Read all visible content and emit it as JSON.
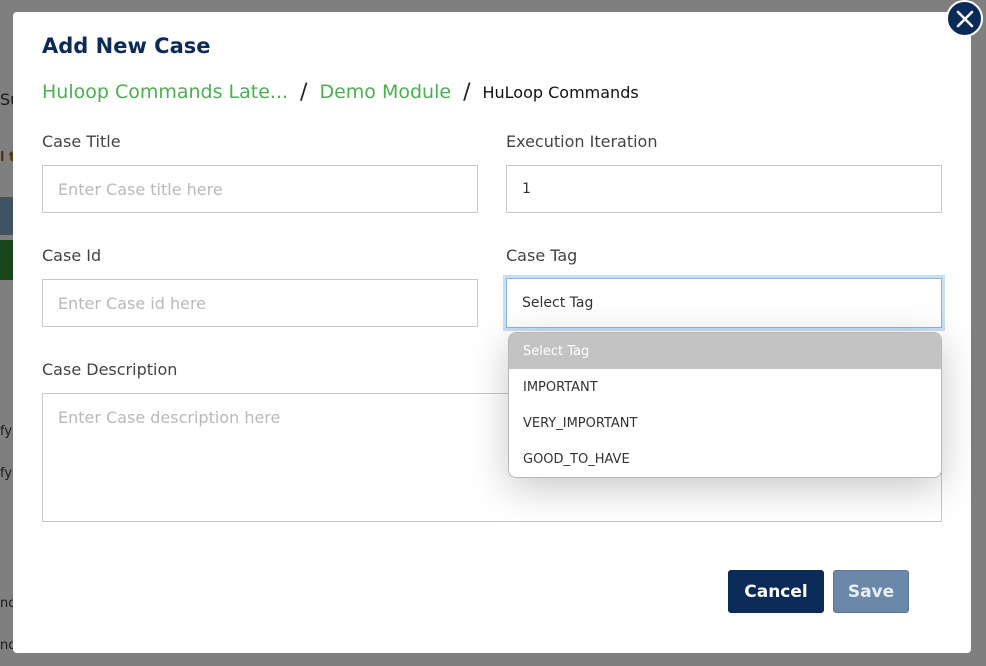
{
  "modal": {
    "title": "Add New Case",
    "breadcrumb": {
      "items": [
        {
          "label": "Huloop Commands Late..."
        },
        {
          "label": "Demo Module"
        }
      ],
      "separator": "/",
      "current": "HuLoop Commands"
    },
    "fields": {
      "case_title": {
        "label": "Case Title",
        "placeholder": "Enter Case title here",
        "value": ""
      },
      "execution_iteration": {
        "label": "Execution Iteration",
        "value": "1"
      },
      "case_id": {
        "label": "Case Id",
        "placeholder": "Enter Case id here",
        "value": ""
      },
      "case_tag": {
        "label": "Case Tag",
        "selected": "Select Tag",
        "options": [
          "Select Tag",
          "IMPORTANT",
          "VERY_IMPORTANT",
          "GOOD_TO_HAVE"
        ]
      },
      "case_description": {
        "label": "Case Description",
        "placeholder": "Enter Case description here",
        "value": ""
      }
    },
    "buttons": {
      "cancel": "Cancel",
      "save": "Save"
    },
    "close_icon": "close-icon"
  },
  "background": {
    "fragments": [
      "Su",
      "l t",
      "fy",
      "fy",
      "nd",
      "nd"
    ]
  },
  "colors": {
    "primary": "#0a2a57",
    "breadcrumb_link": "#4caf50",
    "save_button": "#6b88a8",
    "option_highlight": "#c3c3c3",
    "focus_ring": "#c9def7"
  }
}
